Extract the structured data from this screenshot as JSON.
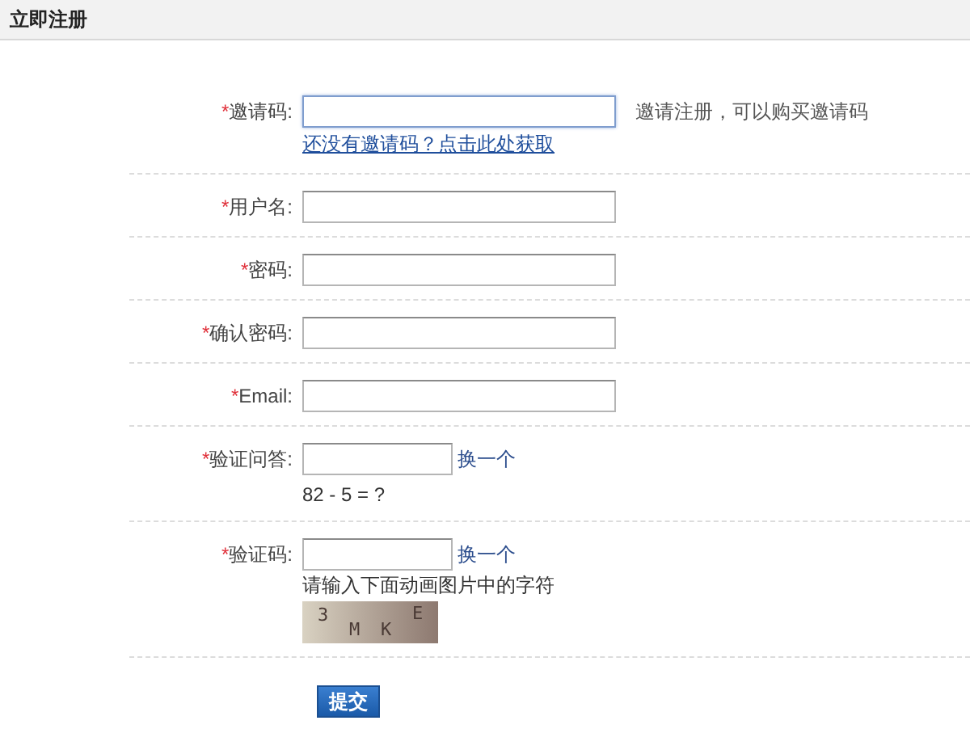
{
  "header": {
    "title": "立即注册"
  },
  "required_mark": "*",
  "fields": [
    {
      "kind": "text",
      "label": "邀请码:",
      "required": true,
      "focused": true,
      "note": "邀请注册，可以购买邀请码",
      "link": "还没有邀请码？点击此处获取"
    },
    {
      "kind": "text",
      "label": "用户名:",
      "required": true,
      "focused": false
    },
    {
      "kind": "text",
      "label": "密码:",
      "required": true,
      "focused": false
    },
    {
      "kind": "text",
      "label": "确认密码:",
      "required": true,
      "focused": false
    },
    {
      "kind": "text",
      "label": "Email:",
      "required": true,
      "focused": false
    },
    {
      "kind": "question",
      "label": "验证问答:",
      "required": true,
      "focused": false,
      "refresh": "换一个",
      "question": "82 - 5 = ?"
    },
    {
      "kind": "captcha",
      "label": "验证码:",
      "required": true,
      "focused": false,
      "refresh": "换一个",
      "hint": "请输入下面动画图片中的字符",
      "captcha_chars": [
        "3",
        "M",
        "K",
        "E"
      ]
    }
  ],
  "submit": "提交"
}
